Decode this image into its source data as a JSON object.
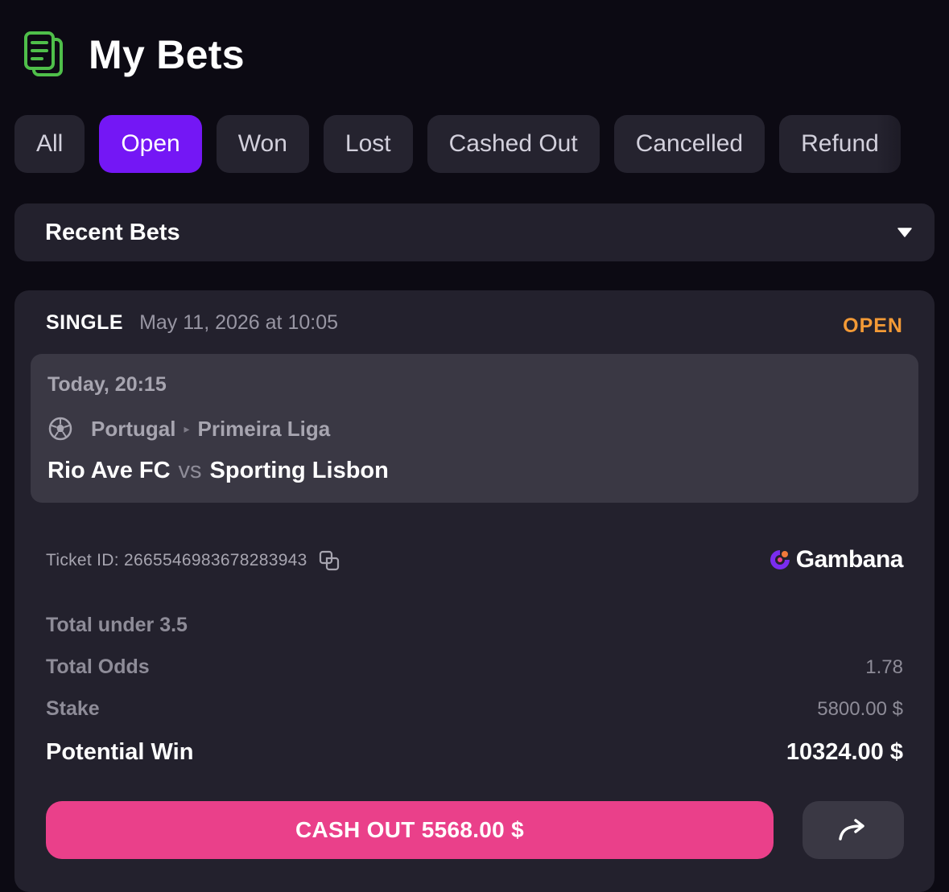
{
  "header": {
    "title": "My Bets",
    "icon": "bet-slip-icon"
  },
  "tabs": [
    {
      "label": "All",
      "active": false
    },
    {
      "label": "Open",
      "active": true
    },
    {
      "label": "Won",
      "active": false
    },
    {
      "label": "Lost",
      "active": false
    },
    {
      "label": "Cashed Out",
      "active": false
    },
    {
      "label": "Cancelled",
      "active": false
    },
    {
      "label": "Refund",
      "active": false
    }
  ],
  "dropdown": {
    "selected": "Recent Bets",
    "icon": "caret-down-icon"
  },
  "bet": {
    "type": "SINGLE",
    "placed_at": "May 11, 2026 at 10:05",
    "status": "OPEN",
    "event": {
      "time": "Today, 20:15",
      "country": "Portugal",
      "league": "Primeira Liga",
      "home": "Rio Ave FC",
      "vs": "vs",
      "away": "Sporting Lisbon",
      "sport_icon": "soccer-ball-icon"
    },
    "ticket": "Ticket ID: 2665546983678283943",
    "provider": "Gambana",
    "selection": "Total under 3.5",
    "total_odds_label": "Total Odds",
    "total_odds": "1.78",
    "stake_label": "Stake",
    "stake": "5800.00 $",
    "potential_win_label": "Potential Win",
    "potential_win": "10324.00 $",
    "cashout_label": "CASH OUT 5568.00 $",
    "share_icon": "share-arrow-icon"
  },
  "colors": {
    "background": "#0c0a13",
    "accent": "#7417f5",
    "status_open": "#f39a36",
    "cashout": "#ea408a",
    "header_icon": "#4fbf4a"
  }
}
